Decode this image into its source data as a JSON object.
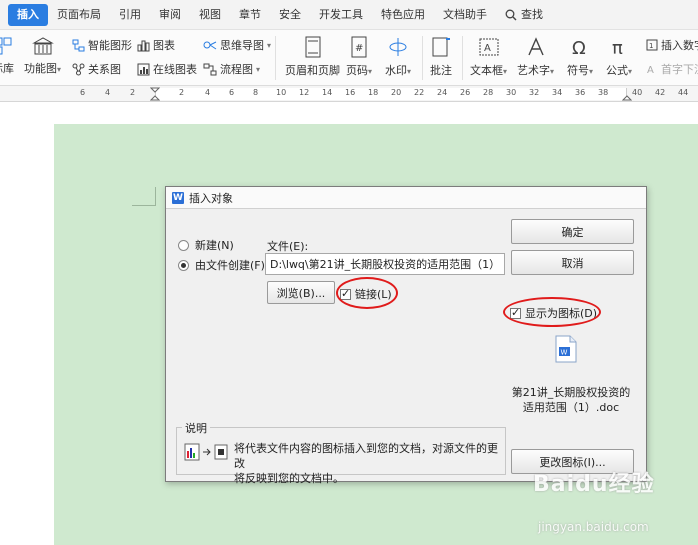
{
  "ribbon": {
    "tabs": [
      {
        "label": "插入",
        "active": true
      },
      {
        "label": "页面布局"
      },
      {
        "label": "引用"
      },
      {
        "label": "审阅"
      },
      {
        "label": "视图"
      },
      {
        "label": "章节"
      },
      {
        "label": "安全"
      },
      {
        "label": "开发工具"
      },
      {
        "label": "特色应用"
      },
      {
        "label": "文档助手"
      }
    ],
    "search_label": "查找",
    "tools": {
      "shape_lib": "标库",
      "function_chart": "功能图",
      "smart_shape": "智能图形",
      "chart": "图表",
      "mind_map": "思维导图",
      "relation_map": "关系图",
      "online_chart": "在线图表",
      "flowchart": "流程图",
      "header_footer": "页眉和页脚",
      "page_number": "页码",
      "watermark": "水印",
      "comment": "批注",
      "textbox": "文本框",
      "art_text": "艺术字",
      "symbol": "符号",
      "formula": "公式",
      "insert_number": "插入数字",
      "drop_cap": "首字下沉"
    }
  },
  "ruler": {
    "labels": [
      "6",
      "4",
      "2",
      "2",
      "4",
      "6",
      "8",
      "10",
      "12",
      "14",
      "16",
      "18",
      "20",
      "22",
      "24",
      "26",
      "28",
      "30",
      "32",
      "34",
      "36",
      "38",
      "40",
      "42",
      "44"
    ]
  },
  "dialog": {
    "logo_letter": "W",
    "title": "插入对象",
    "radio_new": "新建(N)",
    "radio_from_file": "由文件创建(F)",
    "file_label": "文件(E):",
    "file_value": "D:\\lwq\\第21讲_长期股权投资的适用范围（1）.doc",
    "browse_button": "浏览(B)...",
    "link_checkbox": "链接(L)",
    "ok_button": "确定",
    "cancel_button": "取消",
    "display_as_icon": "显示为图标(D)",
    "icon_caption_line1": "第21讲_长期股权投资的",
    "icon_caption_line2": "适用范围（1）.doc",
    "description_legend": "说明",
    "description_line1": "将代表文件内容的图标插入到您的文档，对源文件的更改",
    "description_line2": "将反映到您的文档中。",
    "change_icon_button": "更改图标(I)..."
  },
  "watermark": {
    "brand": "Baidu经验",
    "url": "jingyan.baidu.com"
  },
  "colors": {
    "accent_tab": "#2a7de1",
    "page_background": "#cfe9cf",
    "annotation_circle": "#e01b1b"
  }
}
